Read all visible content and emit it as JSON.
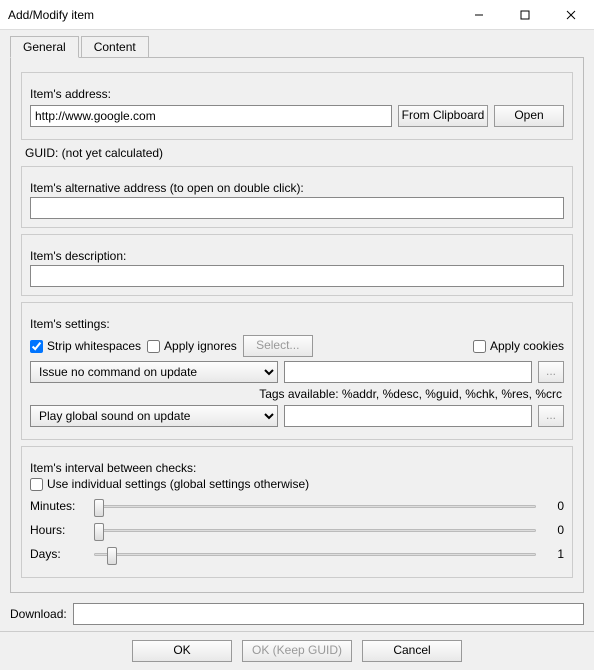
{
  "window": {
    "title": "Add/Modify item"
  },
  "tabs": {
    "general": "General",
    "content": "Content"
  },
  "labels": {
    "address": "Item's address:",
    "guid": "GUID: (not yet calculated)",
    "altaddr": "Item's alternative address (to open on double click):",
    "desc": "Item's description:",
    "settings": "Item's settings:",
    "interval": "Item's interval between checks:",
    "minutes": "Minutes:",
    "hours": "Hours:",
    "days": "Days:",
    "download": "Download:",
    "tags": "Tags available:   %addr, %desc, %guid, %chk, %res, %crc"
  },
  "fields": {
    "address": "http://www.google.com",
    "altaddr": "",
    "desc": "",
    "command_param": "",
    "sound_param": ""
  },
  "buttons": {
    "fromclip": "From Clipboard",
    "open": "Open",
    "select": "Select...",
    "ok": "OK",
    "okguid": "OK (Keep GUID)",
    "cancel": "Cancel",
    "browse": "..."
  },
  "checks": {
    "strip": "Strip whitespaces",
    "applyignores": "Apply ignores",
    "applycookies": "Apply cookies",
    "useindividual": "Use individual settings (global settings otherwise)"
  },
  "selects": {
    "command": "Issue no command on update",
    "sound": "Play global sound on update"
  },
  "sliders": {
    "minutes": "0",
    "hours": "0",
    "days": "1"
  }
}
